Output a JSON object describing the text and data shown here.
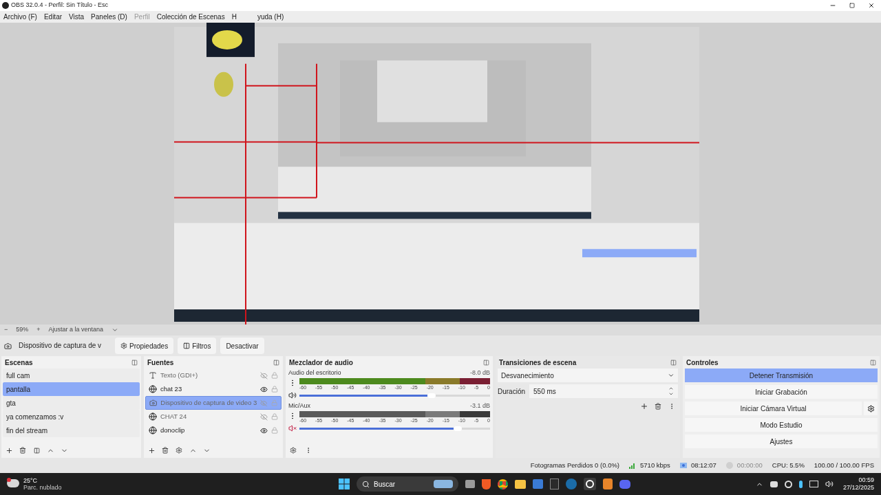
{
  "window": {
    "title": "OBS 32.0.4 - Perfil: Sin Título - Esc"
  },
  "menu": [
    {
      "label": "Archivo (F)",
      "disabled": false
    },
    {
      "label": "Editar",
      "disabled": false
    },
    {
      "label": "Vista",
      "disabled": false
    },
    {
      "label": "Paneles (D)",
      "disabled": false
    },
    {
      "label": "Perfil",
      "disabled": true
    },
    {
      "label": "Colección de Escenas",
      "disabled": false
    },
    {
      "label": "H",
      "disabled": false
    },
    {
      "label": "yuda (H)",
      "disabled": false
    }
  ],
  "zoom_bar": {
    "minus": "−",
    "zoom": "59%",
    "plus": "+",
    "fit": "Ajustar a la ventana"
  },
  "source_toolbar": {
    "source": "Dispositivo de captura de v",
    "buttons": [
      "Propiedades",
      "Filtros",
      "Desactivar"
    ]
  },
  "scenes": {
    "title": "Escenas",
    "items": [
      {
        "name": "full cam",
        "selected": false
      },
      {
        "name": "pantalla",
        "selected": true
      },
      {
        "name": "gta",
        "selected": false
      },
      {
        "name": "ya comenzamos :v",
        "selected": false
      },
      {
        "name": "fin del stream",
        "selected": false
      }
    ]
  },
  "sources": {
    "title": "Fuentes",
    "items": [
      {
        "name": "Texto (GDI+)",
        "kind": "text",
        "visible": false,
        "selected": false
      },
      {
        "name": "chat 23",
        "kind": "browser",
        "visible": true,
        "selected": false
      },
      {
        "name": "Dispositivo de captura de video 3",
        "kind": "camera",
        "visible": false,
        "selected": true
      },
      {
        "name": "CHAT 24",
        "kind": "browser",
        "visible": false,
        "selected": false
      },
      {
        "name": "donoclip",
        "kind": "browser",
        "visible": true,
        "selected": false
      }
    ]
  },
  "mixer": {
    "title": "Mezclador de audio",
    "channels": [
      {
        "name": "Audio del escritorio",
        "reading": "-8.0 dB",
        "muted": false,
        "level": 0.67,
        "scale": [
          "-60",
          "-55",
          "-50",
          "-45",
          "-40",
          "-35",
          "-30",
          "-25",
          "-20",
          "-15",
          "-10",
          "-5",
          "0"
        ]
      },
      {
        "name": "Mic/Aux",
        "reading": "-3.1 dB",
        "muted": true,
        "level": 0.81,
        "scale": [
          "-60",
          "-55",
          "-50",
          "-45",
          "-40",
          "-35",
          "-30",
          "-25",
          "-20",
          "-15",
          "-10",
          "-5",
          "0"
        ]
      }
    ]
  },
  "transitions": {
    "title": "Transiciones de escena",
    "transition": "Desvanecimiento",
    "duration_label": "Duración",
    "duration": "550 ms"
  },
  "controls": {
    "title": "Controles",
    "buttons": [
      {
        "label": "Detener Transmisión",
        "kind": "plain",
        "selected": true
      },
      {
        "label": "Iniciar Grabación",
        "kind": "plain",
        "selected": false
      },
      {
        "label": "Iniciar Cámara Virtual",
        "kind": "with_settings",
        "selected": false
      },
      {
        "label": "Modo Estudio",
        "kind": "plain",
        "selected": false
      },
      {
        "label": "Ajustes",
        "kind": "plain",
        "selected": false
      }
    ]
  },
  "status_bar": {
    "dropped": "Fotogramas Perdidos 0 (0.0%)",
    "bitrate": "5710 kbps",
    "stream_time": "08:12:07",
    "record_time": "00:00:00",
    "cpu": "CPU: 5.5%",
    "fps": "100.00 / 100.00 FPS"
  },
  "taskbar": {
    "temperature": "25°C",
    "weather": "Parc. nublado",
    "search": "Buscar",
    "time": "00:59",
    "date": "27/12/2025"
  }
}
